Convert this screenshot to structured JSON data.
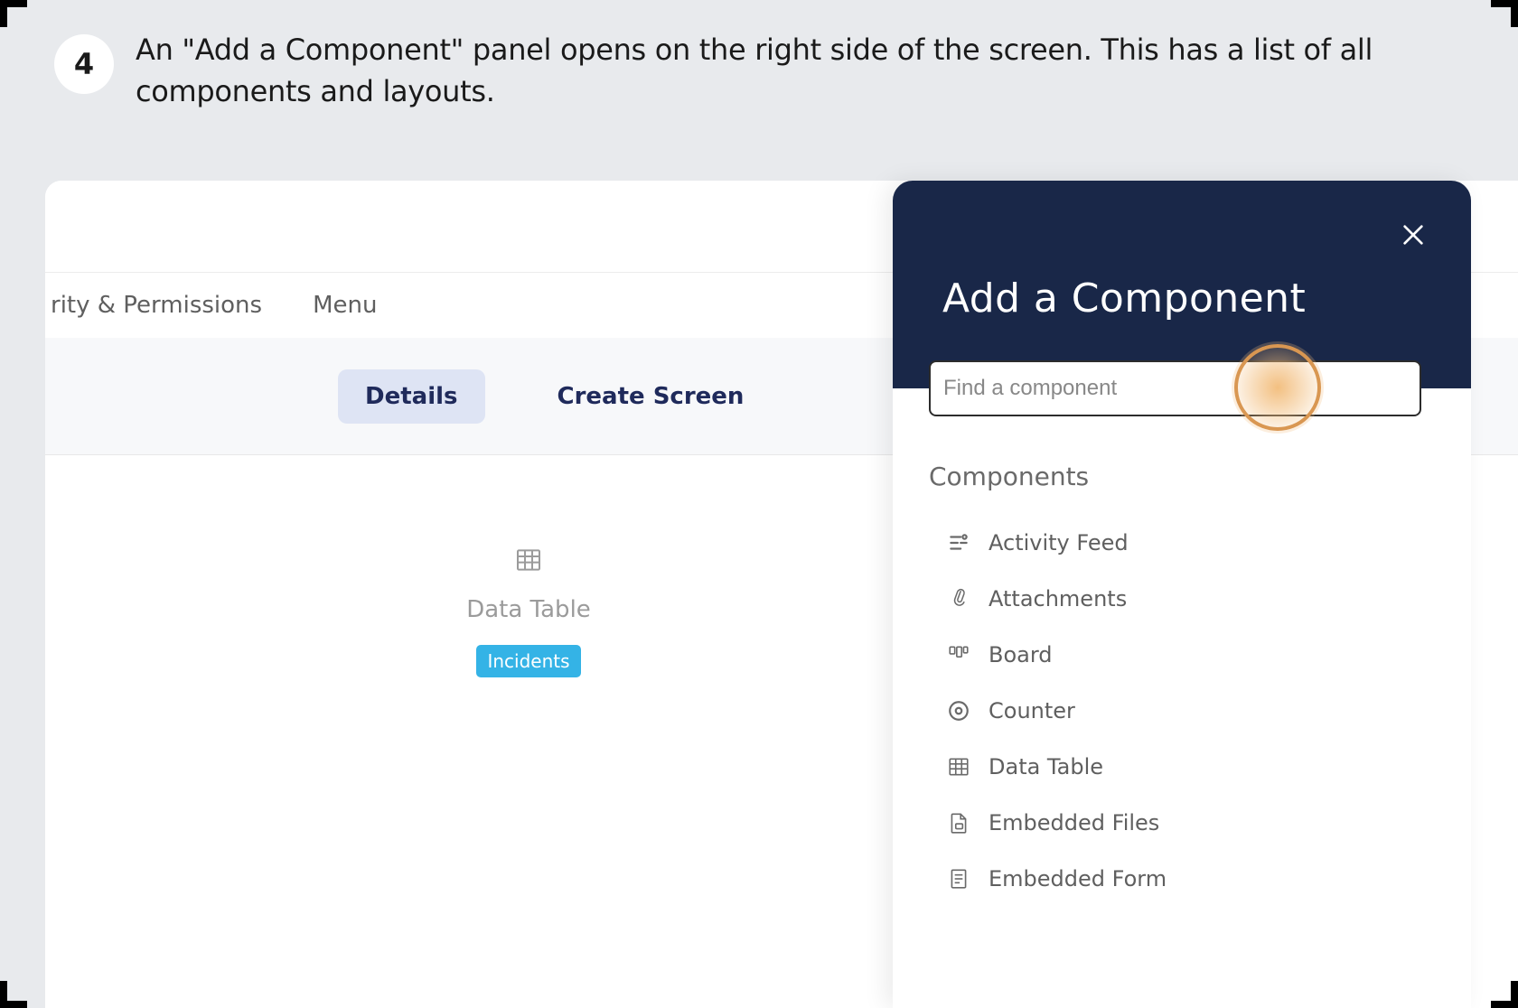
{
  "step": {
    "number": "4",
    "description": "An \"Add a Component\" panel opens on the right side of the screen. This has a list of all components and layouts."
  },
  "nav": {
    "item_permissions": "rity & Permissions",
    "item_menu": "Menu"
  },
  "tabs": {
    "details": "Details",
    "create_screen": "Create Screen"
  },
  "placeholder": {
    "title": "Data Table",
    "tag": "Incidents"
  },
  "panel": {
    "title": "Add a Component",
    "search_placeholder": "Find a component",
    "section_label": "Components",
    "items": [
      {
        "label": "Activity Feed",
        "icon": "activity"
      },
      {
        "label": "Attachments",
        "icon": "attachment"
      },
      {
        "label": "Board",
        "icon": "board"
      },
      {
        "label": "Counter",
        "icon": "counter"
      },
      {
        "label": "Data Table",
        "icon": "table"
      },
      {
        "label": "Embedded Files",
        "icon": "file"
      },
      {
        "label": "Embedded Form",
        "icon": "form"
      }
    ]
  }
}
